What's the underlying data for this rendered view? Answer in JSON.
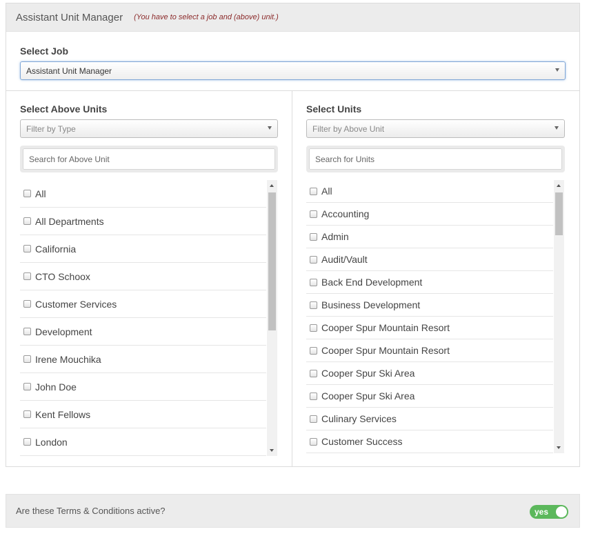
{
  "header": {
    "title": "Assistant Unit Manager",
    "note": "(You have to select a job and (above) unit.)"
  },
  "job": {
    "label": "Select Job",
    "selected": "Assistant Unit Manager"
  },
  "above_units": {
    "label": "Select Above Units",
    "filter_placeholder": "Filter by Type",
    "search_placeholder": "Search for Above Unit",
    "items": [
      "All",
      "All Departments",
      "California",
      "CTO Schoox",
      "Customer Services",
      "Development",
      "Irene Mouchika",
      "John Doe",
      "Kent Fellows",
      "London"
    ]
  },
  "units": {
    "label": "Select Units",
    "filter_placeholder": "Filter by Above Unit",
    "search_placeholder": "Search for Units",
    "items": [
      "All",
      "Accounting",
      "Admin",
      "Audit/Vault",
      "Back End Development",
      "Business Development",
      "Cooper Spur Mountain Resort",
      "Cooper Spur Mountain Resort",
      "Cooper Spur Ski Area",
      "Cooper Spur Ski Area",
      "Culinary Services",
      "Customer Success"
    ]
  },
  "terms": {
    "question": "Are these Terms & Conditions active?",
    "toggle_label": "yes",
    "toggle_on": true,
    "toggle_color": "#5cb85c"
  }
}
